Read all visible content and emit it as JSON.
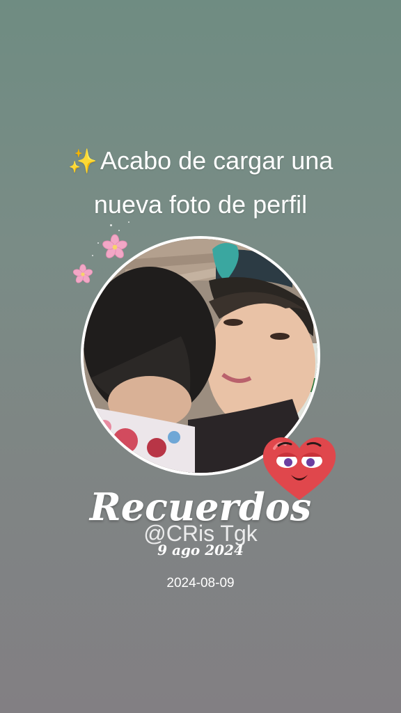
{
  "post": {
    "sparkle_icon": "✨",
    "headline_line1": "Acabo de cargar una",
    "headline_line2": "nueva foto de perfil",
    "title": "Recuerdos",
    "handle": "@CRis Tgk",
    "date_script": "9 ago 2024",
    "date": "2024-08-09"
  },
  "icons": {
    "flower": "pink-flower-icon",
    "heart": "heart-face-sticker"
  },
  "colors": {
    "background_top": "#6f8c82",
    "background_bottom": "#827f83",
    "heart": "#e0474c",
    "flower": "#f2a7c6",
    "text": "#ffffff"
  }
}
